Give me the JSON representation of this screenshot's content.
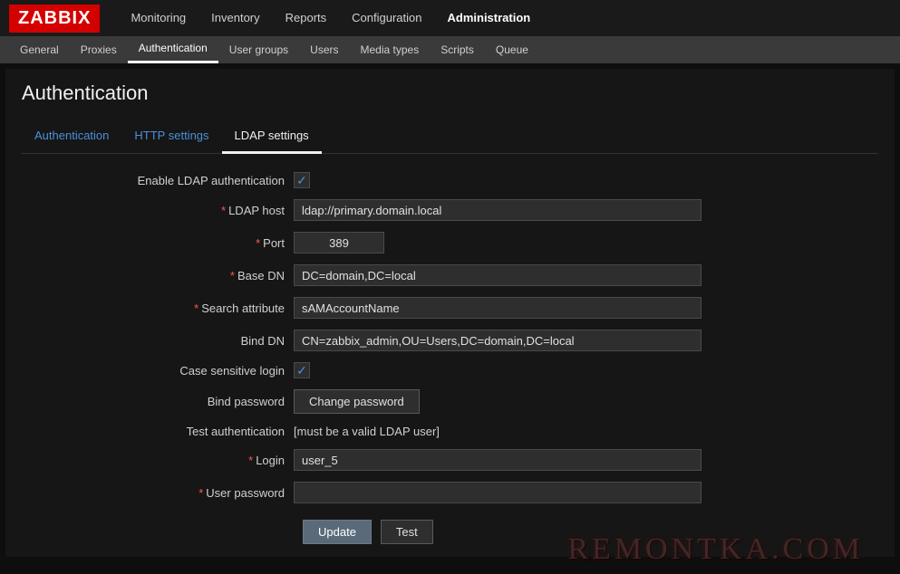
{
  "logo": "ZABBIX",
  "topnav": {
    "items": [
      {
        "label": "Monitoring"
      },
      {
        "label": "Inventory"
      },
      {
        "label": "Reports"
      },
      {
        "label": "Configuration"
      },
      {
        "label": "Administration",
        "active": true
      }
    ]
  },
  "subnav": {
    "items": [
      {
        "label": "General"
      },
      {
        "label": "Proxies"
      },
      {
        "label": "Authentication",
        "active": true
      },
      {
        "label": "User groups"
      },
      {
        "label": "Users"
      },
      {
        "label": "Media types"
      },
      {
        "label": "Scripts"
      },
      {
        "label": "Queue"
      }
    ]
  },
  "page": {
    "title": "Authentication"
  },
  "tabs": {
    "items": [
      {
        "label": "Authentication"
      },
      {
        "label": "HTTP settings"
      },
      {
        "label": "LDAP settings",
        "active": true
      }
    ]
  },
  "form": {
    "enable_label": "Enable LDAP authentication",
    "enable_checked": true,
    "host_label": "LDAP host",
    "host_value": "ldap://primary.domain.local",
    "port_label": "Port",
    "port_value": "389",
    "basedn_label": "Base DN",
    "basedn_value": "DC=domain,DC=local",
    "search_label": "Search attribute",
    "search_value": "sAMAccountName",
    "binddn_label": "Bind DN",
    "binddn_value": "CN=zabbix_admin,OU=Users,DC=domain,DC=local",
    "case_label": "Case sensitive login",
    "case_checked": true,
    "bindpw_label": "Bind password",
    "bindpw_button": "Change password",
    "testauth_label": "Test authentication",
    "testauth_hint": "[must be a valid LDAP user]",
    "login_label": "Login",
    "login_value": "user_5",
    "userpw_label": "User password",
    "userpw_value": "",
    "update_btn": "Update",
    "test_btn": "Test"
  },
  "watermark": "REMONTKA.COM"
}
